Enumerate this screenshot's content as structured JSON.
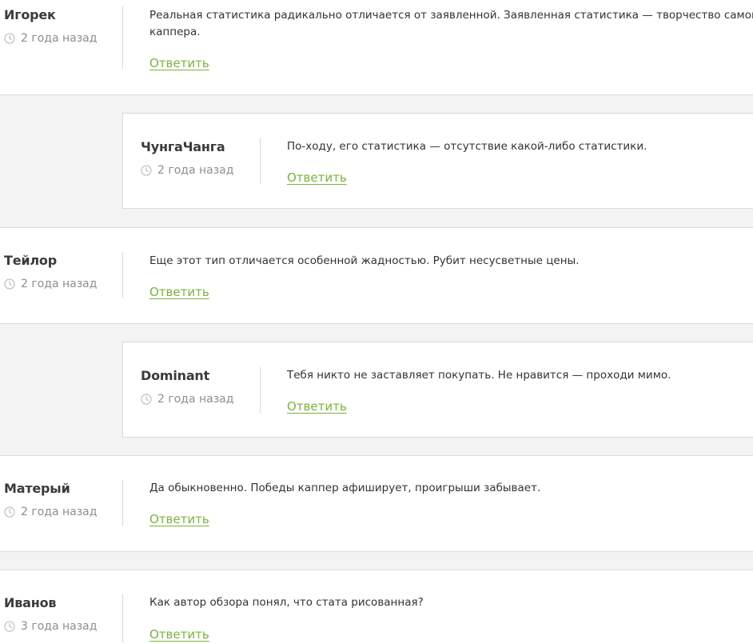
{
  "reply_label": "Ответить",
  "comments": [
    {
      "author": "Игорек",
      "time": "2 года назад",
      "text_line1": "Реальная статистика радикально отличается от заявленной. Заявленная статистика — творчество самого",
      "text_line2": "каппера."
    },
    {
      "author": "ЧунгаЧанга",
      "time": "2 года назад",
      "text_line1": "По-ходу, его статистика — отсутствие какой-либо статистики."
    },
    {
      "author": "Тейлор",
      "time": "2 года назад",
      "text_line1": "Еще этот тип отличается особенной жадностью. Рубит несусветные цены."
    },
    {
      "author": "Dominant",
      "time": "2 года назад",
      "text_line1": "Тебя никто не заставляет покупать. Не нравится — проходи мимо."
    },
    {
      "author": "Матерый",
      "time": "2 года назад",
      "text_line1": "Да обыкновенно. Победы каппер афиширует, проигрыши забывает."
    },
    {
      "author": "Иванов",
      "time": "3 года назад",
      "text_line1": "Как автор обзора понял, что стата рисованная?"
    }
  ],
  "icons": {
    "clock": "clock-icon"
  },
  "colors": {
    "link": "#7bb33a",
    "band": "#f3f3f3",
    "meta": "#8e8e8e"
  }
}
